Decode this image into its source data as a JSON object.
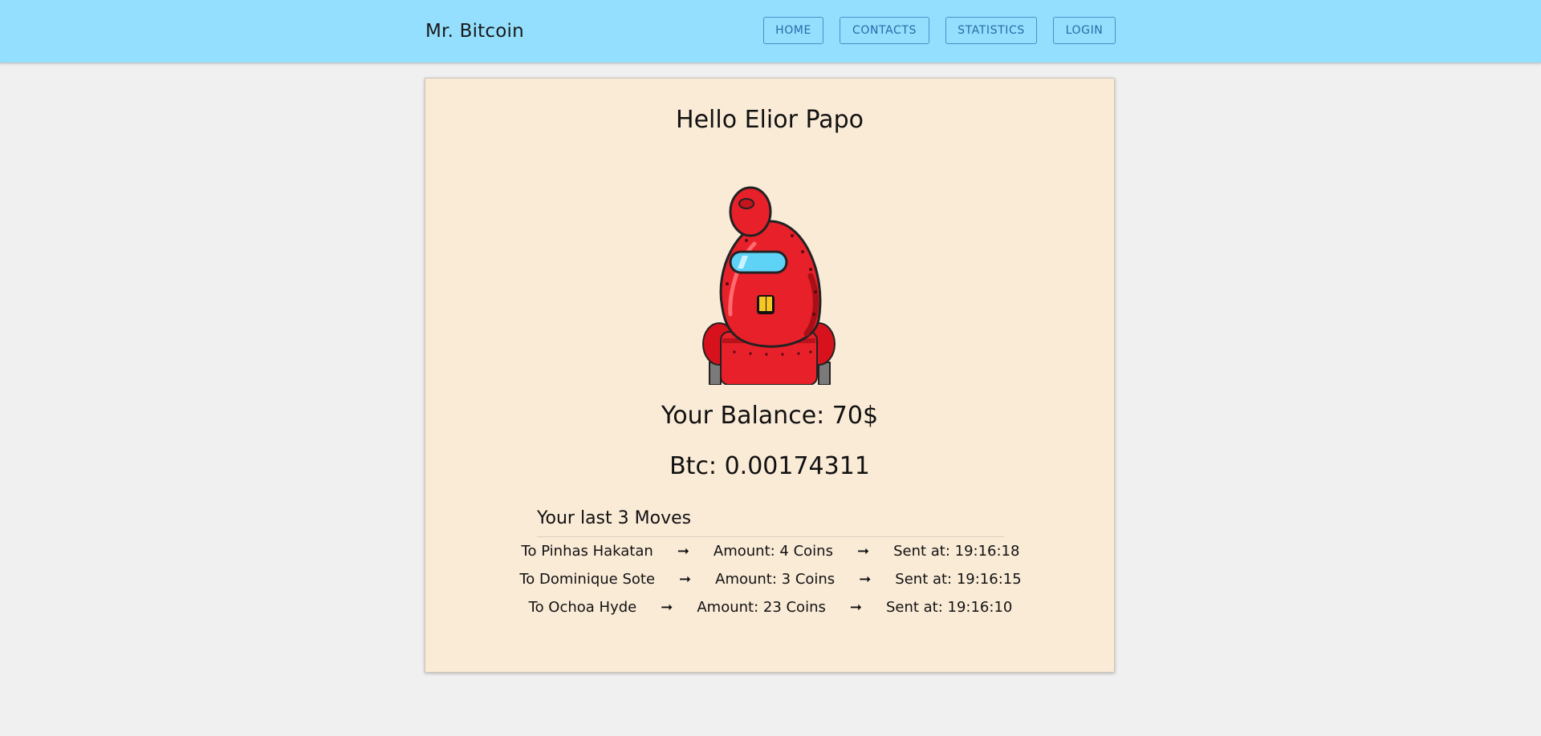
{
  "app": {
    "brand": "Mr. Bitcoin"
  },
  "nav": {
    "home": "HOME",
    "contacts": "CONTACTS",
    "statistics": "STATISTICS",
    "login": "LOGIN"
  },
  "user": {
    "greeting": "Hello Elior Papo",
    "balance": "Your Balance: 70$",
    "btc": "Btc: 0.00174311",
    "avatar_icon": "red-robot-avatar-icon"
  },
  "moves": {
    "title": "Your last 3 Moves",
    "arrow": "➞",
    "items": [
      {
        "to": "To Pinhas Hakatan",
        "amount": "Amount: 4 Coins",
        "sent": "Sent at: 19:16:18"
      },
      {
        "to": "To Dominique Sote",
        "amount": "Amount: 3 Coins",
        "sent": "Sent at: 19:16:15"
      },
      {
        "to": "To Ochoa Hyde",
        "amount": "Amount: 23 Coins",
        "sent": "Sent at: 19:16:10"
      }
    ]
  },
  "colors": {
    "header_bg": "#93dffd",
    "card_bg": "#faebd7",
    "page_bg": "#f0f0f0",
    "nav_border": "#4a8fc9",
    "robot_red": "#e8202a"
  }
}
